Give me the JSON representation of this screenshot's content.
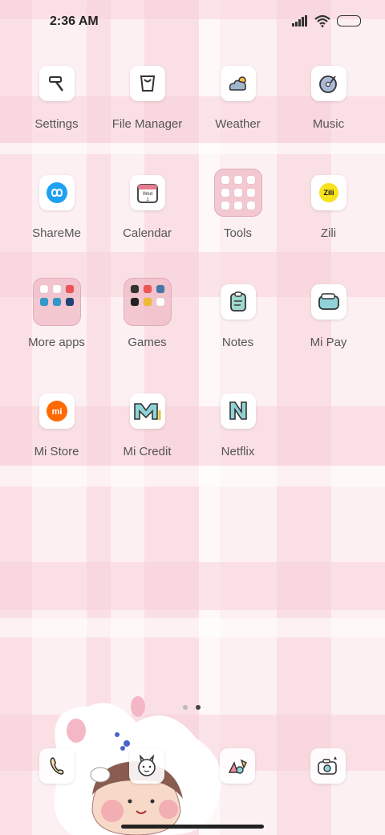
{
  "status": {
    "time": "2:36 AM"
  },
  "apps": [
    {
      "label": "Settings",
      "icon": "hammer-icon"
    },
    {
      "label": "File Manager",
      "icon": "bucket-icon"
    },
    {
      "label": "Weather",
      "icon": "cloud-sun-icon"
    },
    {
      "label": "Music",
      "icon": "record-icon"
    },
    {
      "label": "ShareMe",
      "icon": "infinity-icon"
    },
    {
      "label": "Calendar",
      "icon": "calendar-icon",
      "icon_text": "Wed 1"
    },
    {
      "label": "Tools",
      "icon": "folder-icon"
    },
    {
      "label": "Zili",
      "icon": "zili-icon",
      "icon_text": "Zili"
    },
    {
      "label": "More apps",
      "icon": "folder-icon"
    },
    {
      "label": "Games",
      "icon": "folder-icon"
    },
    {
      "label": "Notes",
      "icon": "notes-icon"
    },
    {
      "label": "Mi Pay",
      "icon": "wallet-icon"
    },
    {
      "label": "Mi Store",
      "icon": "mi-icon",
      "icon_text": "mi"
    },
    {
      "label": "Mi Credit",
      "icon": "m-letter-icon"
    },
    {
      "label": "Netflix",
      "icon": "n-letter-icon"
    }
  ],
  "dock": [
    {
      "icon": "phone-icon"
    },
    {
      "icon": "messages-icon"
    },
    {
      "icon": "browser-icon"
    },
    {
      "icon": "camera-icon"
    }
  ],
  "colors": {
    "accent_pink": "#f6cdd5",
    "icon_teal": "#8fd3d6"
  }
}
